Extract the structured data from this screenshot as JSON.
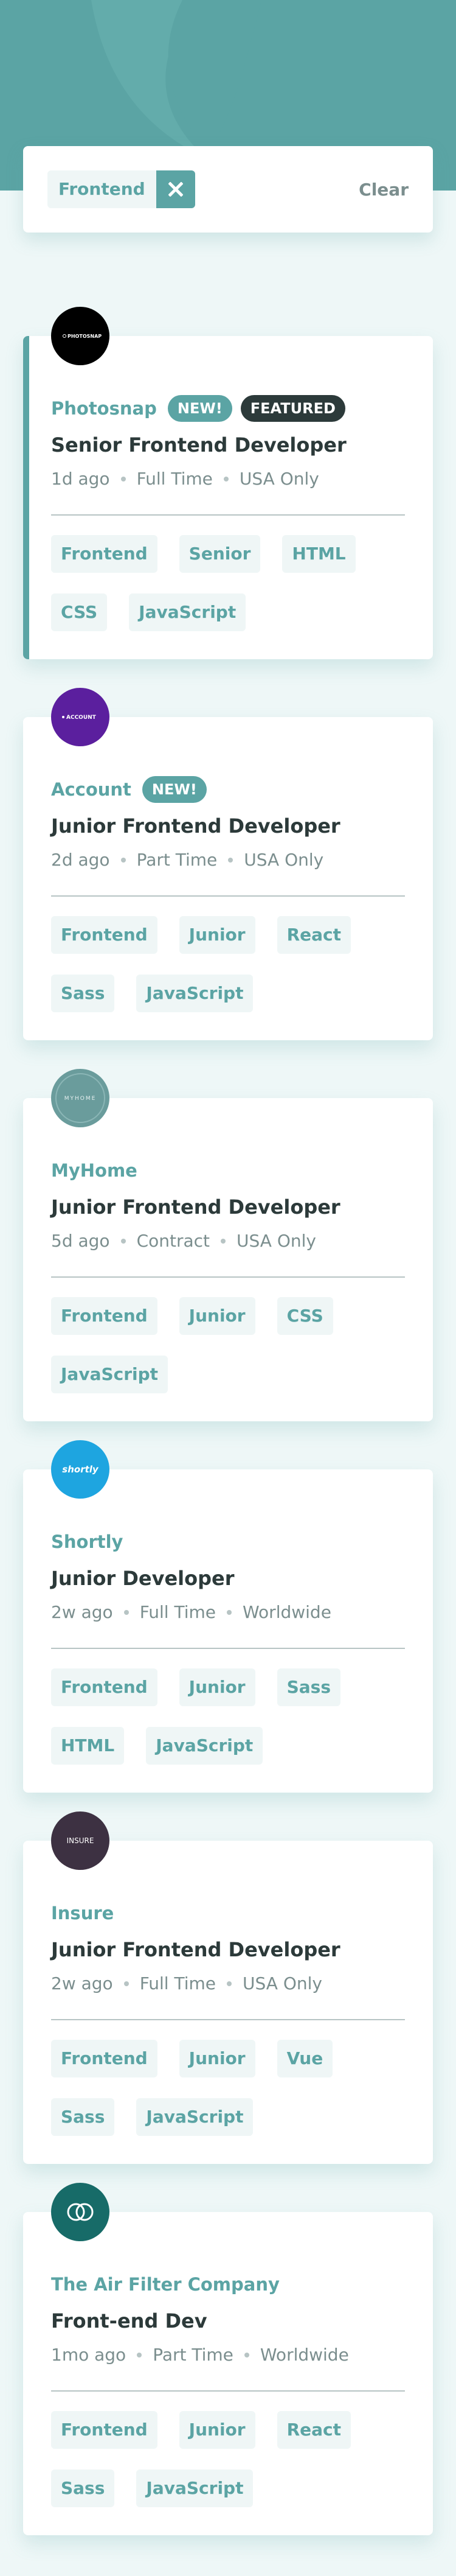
{
  "filters": {
    "active": [
      "Frontend"
    ],
    "clear_label": "Clear"
  },
  "jobs": [
    {
      "logo_text": "PHOTOSNAP",
      "logo_color": "#000000",
      "company": "Photosnap",
      "new_label": "NEW!",
      "featured_label": "FEATURED",
      "position": "Senior Frontend Developer",
      "posted": "1d ago",
      "contract": "Full Time",
      "location": "USA Only",
      "tags": [
        "Frontend",
        "Senior",
        "HTML",
        "CSS",
        "JavaScript"
      ]
    },
    {
      "logo_text": "ACCOUNT",
      "logo_color": "#5b1f9e",
      "company": "Account",
      "new_label": "NEW!",
      "position": "Junior Frontend Developer",
      "posted": "2d ago",
      "contract": "Part Time",
      "location": "USA Only",
      "tags": [
        "Frontend",
        "Junior",
        "React",
        "Sass",
        "JavaScript"
      ]
    },
    {
      "logo_text": "MYHOME",
      "logo_color": "#6a9c9c",
      "company": "MyHome",
      "position": "Junior Frontend Developer",
      "posted": "5d ago",
      "contract": "Contract",
      "location": "USA Only",
      "tags": [
        "Frontend",
        "Junior",
        "CSS",
        "JavaScript"
      ]
    },
    {
      "logo_text": "shortly",
      "logo_color": "#1ea5e0",
      "company": "Shortly",
      "position": "Junior Developer",
      "posted": "2w ago",
      "contract": "Full Time",
      "location": "Worldwide",
      "tags": [
        "Frontend",
        "Junior",
        "Sass",
        "HTML",
        "JavaScript"
      ]
    },
    {
      "logo_text": "INSURE",
      "logo_color": "#3d3142",
      "company": "Insure",
      "position": "Junior Frontend Developer",
      "posted": "2w ago",
      "contract": "Full Time",
      "location": "USA Only",
      "tags": [
        "Frontend",
        "Junior",
        "Vue",
        "Sass",
        "JavaScript"
      ]
    },
    {
      "logo_text": "",
      "logo_color": "#176b68",
      "company": "The Air Filter Company",
      "position": "Front-end Dev",
      "posted": "1mo ago",
      "contract": "Part Time",
      "location": "Worldwide",
      "tags": [
        "Frontend",
        "Junior",
        "React",
        "Sass",
        "JavaScript"
      ]
    }
  ]
}
